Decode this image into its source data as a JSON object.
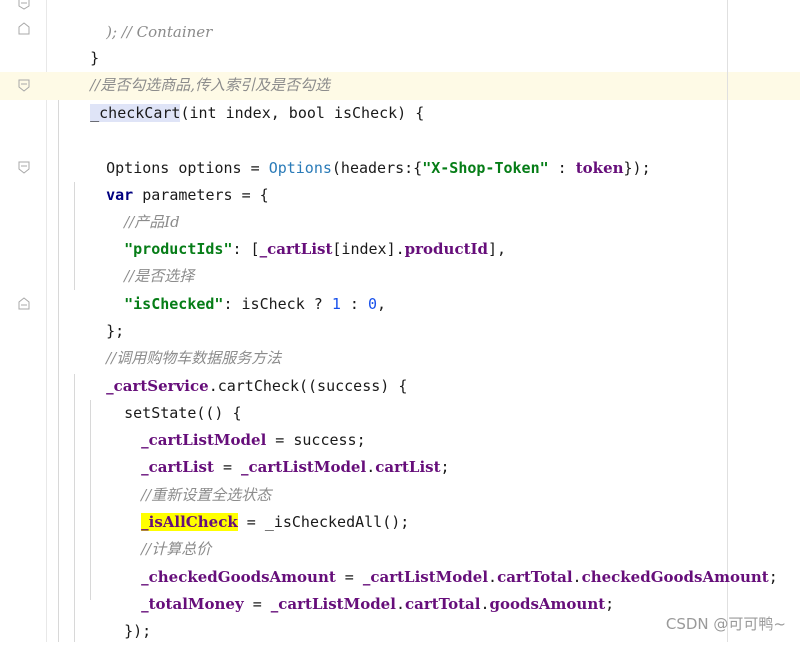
{
  "editor": {
    "lines": [
      {
        "comment_end": "); // Container"
      },
      {
        "brace": "}"
      },
      {
        "comment": "//是否勾选商品,传入索引及是否勾选"
      },
      {
        "method_name": "_checkCart",
        "params": "(int index, bool isCheck) {"
      },
      {
        "blank": ""
      },
      {
        "type1": "Options",
        "var1": " options = ",
        "ctor": "Options",
        "args_open": "(headers:{",
        "key": "\"X-Shop-Token\"",
        "colon": " : ",
        "val": "token",
        "args_close": "});"
      },
      {
        "kw": "var",
        "rest": " parameters = {"
      },
      {
        "comment": "//产品Id"
      },
      {
        "key": "\"productIds\"",
        "mid": ": [",
        "field1": "_cartList",
        "idx": "[index].",
        "field2": "productId",
        "end": "],"
      },
      {
        "comment": "//是否选择"
      },
      {
        "key": "\"isChecked\"",
        "mid": ": isCheck ? ",
        "n1": "1",
        "colon": " : ",
        "n2": "0",
        "end": ","
      },
      {
        "brace": "};"
      },
      {
        "comment": "//调用购物车数据服务方法"
      },
      {
        "field": "_cartService",
        "dot": ".",
        "method": "cartCheck",
        "rest": "((success) {"
      },
      {
        "method": "setState",
        "rest": "(() {"
      },
      {
        "field": "_cartListModel",
        "rest": " = success;"
      },
      {
        "field": "_cartList",
        "eq": " = ",
        "field2": "_cartListModel",
        "dot": ".",
        "field3": "cartList",
        "end": ";"
      },
      {
        "comment": "//重新设置全选状态"
      },
      {
        "field": "_isAllCheck",
        "eq": " = ",
        "call": "_isCheckedAll",
        "end": "();"
      },
      {
        "comment": "//计算总价"
      },
      {
        "field": "_checkedGoodsAmount",
        "eq": " = ",
        "f2": "_cartListModel",
        "d1": ".",
        "f3": "cartTotal",
        "d2": ".",
        "f4": "checkedGoodsAmount",
        "end": ";"
      },
      {
        "field": "_totalMoney",
        "eq": " = ",
        "f2": "_cartListModel",
        "d1": ".",
        "f3": "cartTotal",
        "d2": ".",
        "f4": "goodsAmount",
        "end": ";"
      },
      {
        "brace": "});"
      }
    ]
  },
  "watermark": "CSDN @可可鸭~",
  "colors": {
    "keyword": "#000080",
    "string": "#067d17",
    "number": "#1750eb",
    "comment": "#8c8c8c",
    "field": "#660e7a",
    "current_line": "#fefae6",
    "highlight": "#ffff00"
  }
}
